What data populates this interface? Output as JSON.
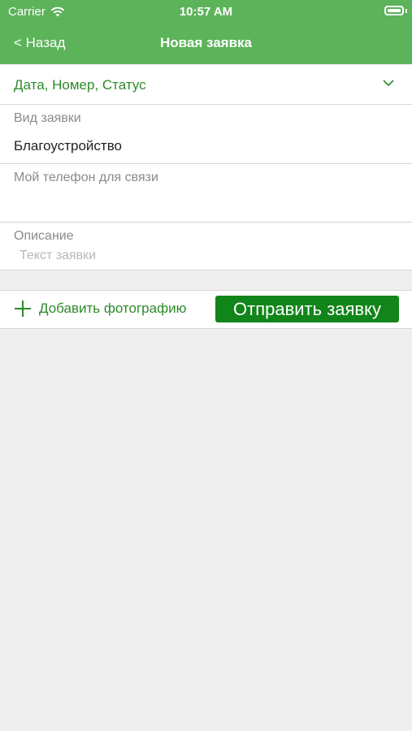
{
  "status_bar": {
    "carrier": "Carrier",
    "time": "10:57 AM"
  },
  "nav": {
    "back_label": "< Назад",
    "title": "Новая заявка"
  },
  "filter": {
    "label": "Дата, Номер, Статус"
  },
  "form": {
    "type_label": "Вид заявки",
    "type_value": "Благоустройство",
    "phone_label": "Мой телефон для связи",
    "phone_value": "",
    "description_label": "Описание",
    "description_placeholder": "Текст заявки"
  },
  "actions": {
    "add_photo_label": "Добавить фотографию",
    "send_label": "Отправить заявку"
  },
  "colors": {
    "header": "#5cb35a",
    "accent": "#2d8a2a",
    "button": "#11851a"
  }
}
